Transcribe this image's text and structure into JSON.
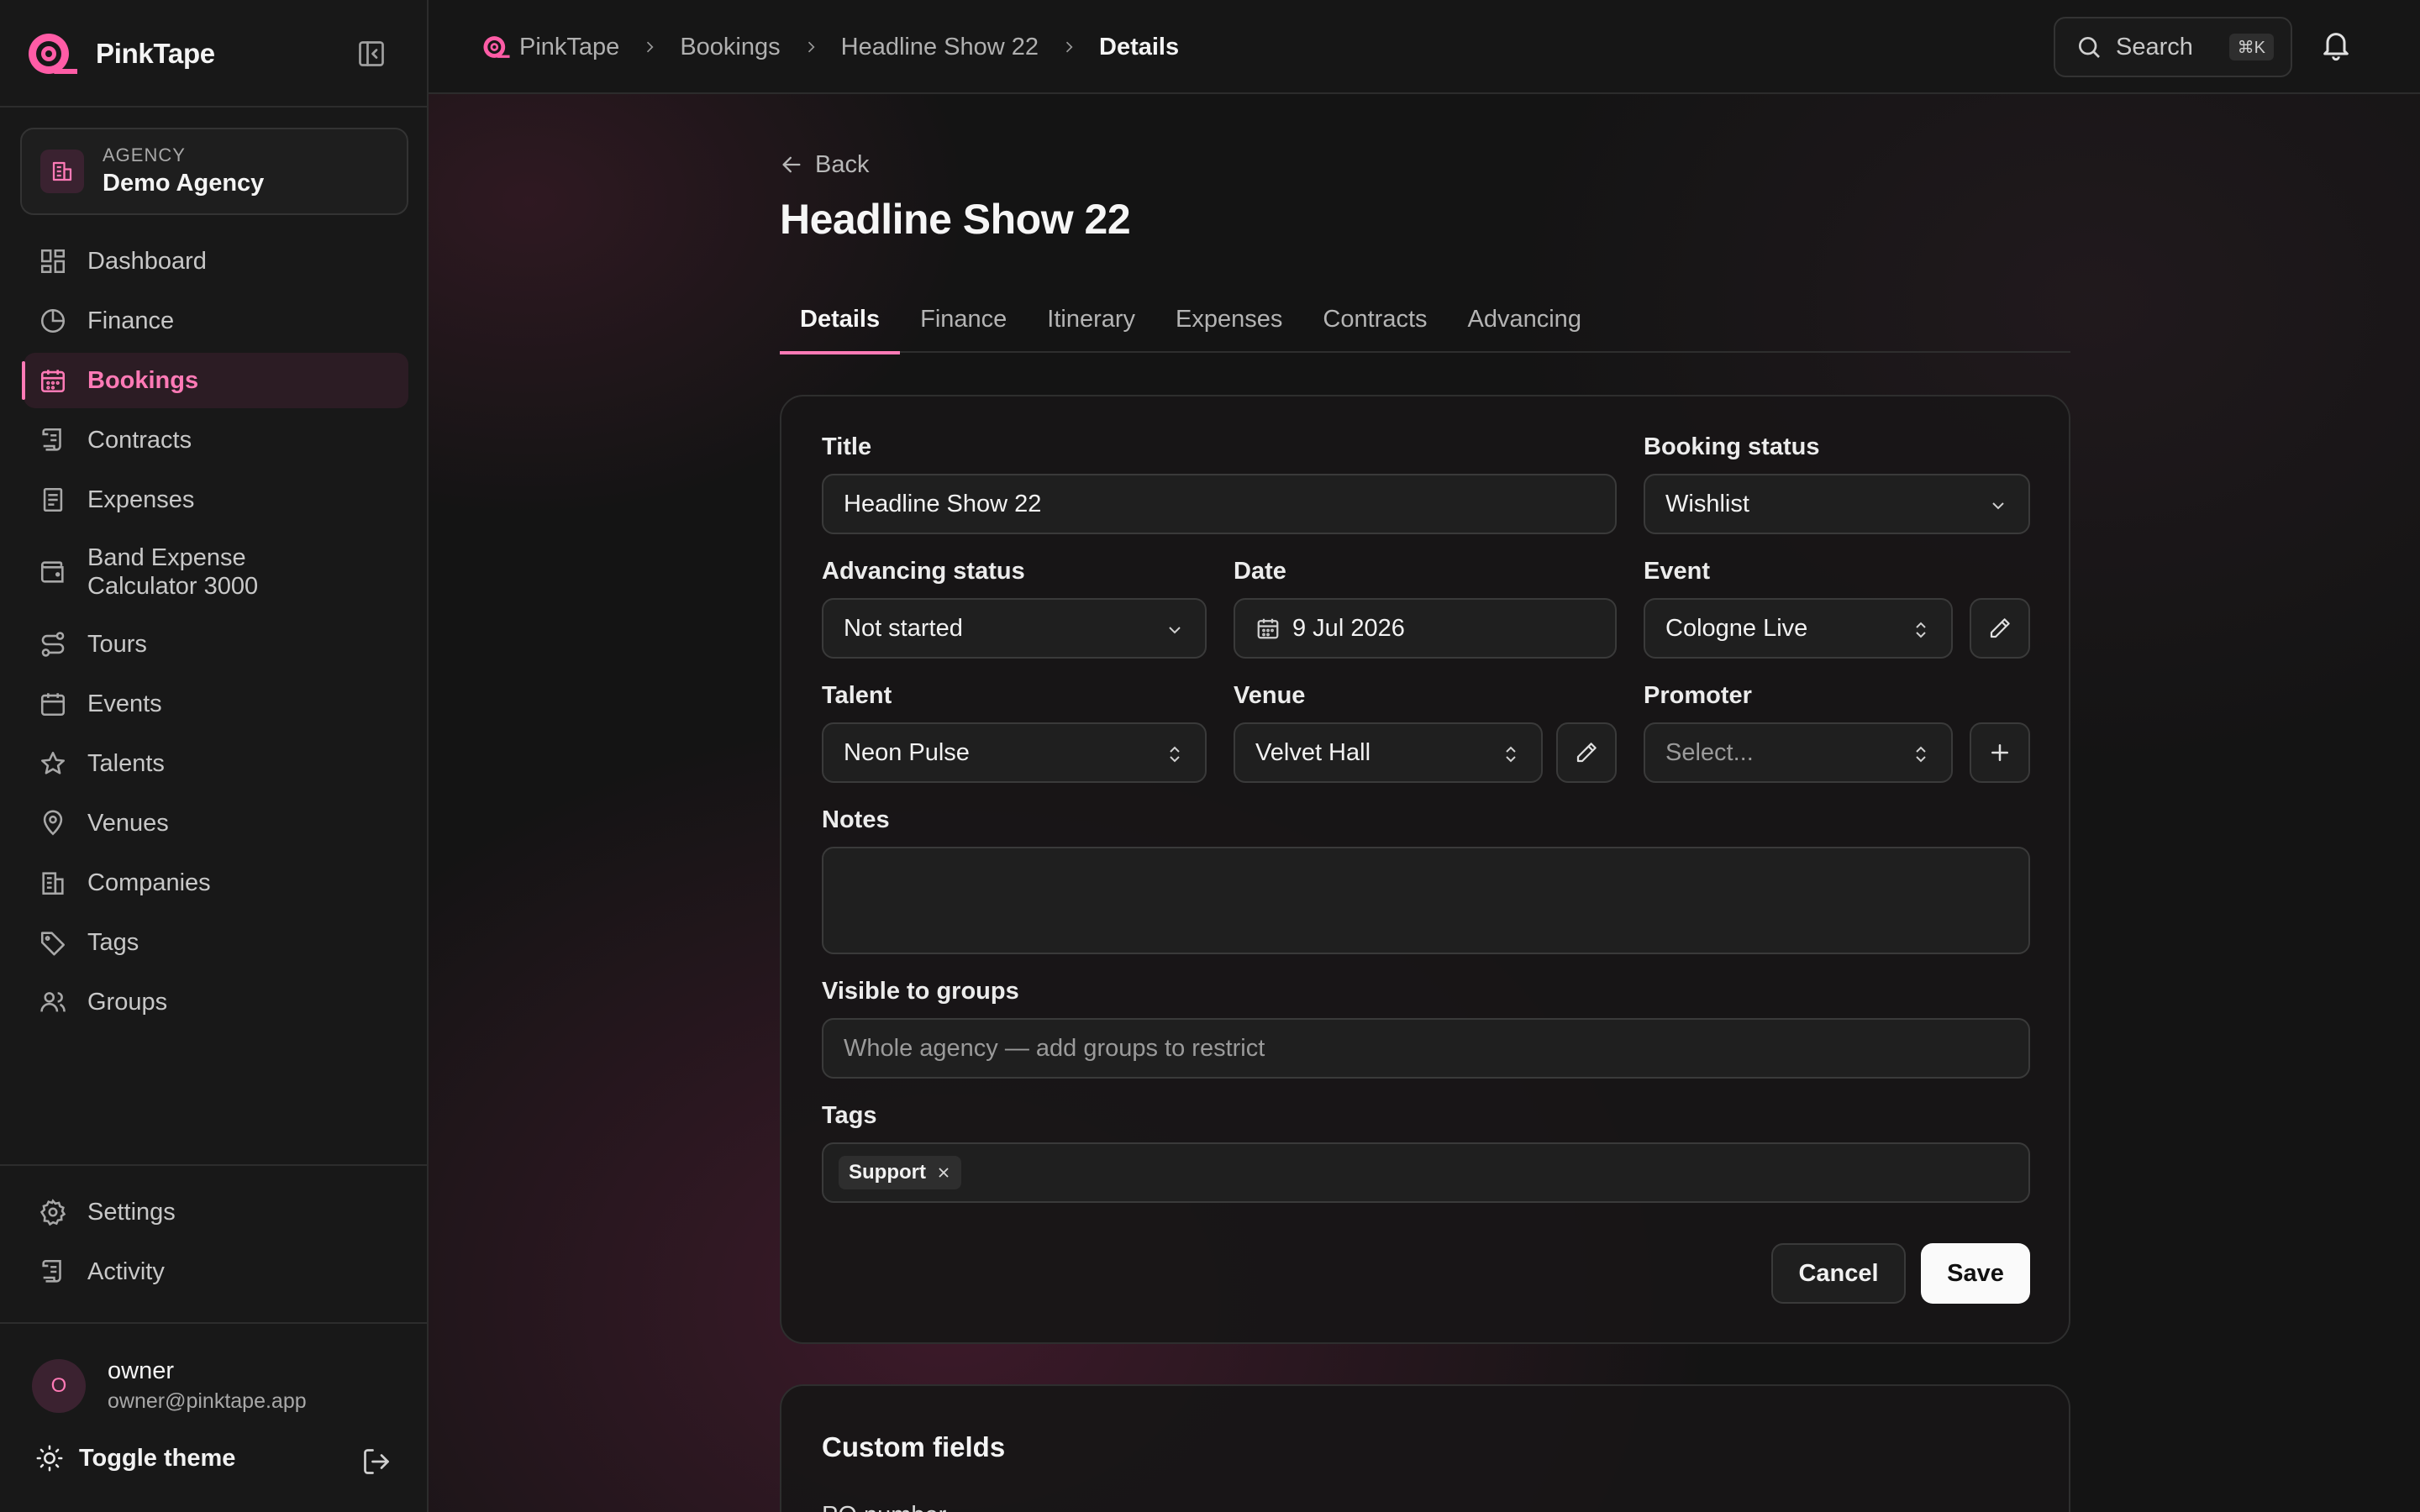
{
  "brand": {
    "name": "PinkTape"
  },
  "agency": {
    "label": "AGENCY",
    "name": "Demo Agency"
  },
  "sidebar": {
    "items": [
      {
        "label": "Dashboard",
        "icon": "dashboard-icon"
      },
      {
        "label": "Finance",
        "icon": "pie-chart-icon"
      },
      {
        "label": "Bookings",
        "icon": "calendar-icon",
        "active": true
      },
      {
        "label": "Contracts",
        "icon": "scroll-icon"
      },
      {
        "label": "Expenses",
        "icon": "receipt-icon"
      },
      {
        "label_line1": "Band Expense",
        "label_line2": "Calculator 3000",
        "icon": "wallet-icon"
      },
      {
        "label": "Tours",
        "icon": "route-icon"
      },
      {
        "label": "Events",
        "icon": "calendar-icon"
      },
      {
        "label": "Talents",
        "icon": "star-icon"
      },
      {
        "label": "Venues",
        "icon": "map-pin-icon"
      },
      {
        "label": "Companies",
        "icon": "building-icon"
      },
      {
        "label": "Tags",
        "icon": "tag-icon"
      },
      {
        "label": "Groups",
        "icon": "users-icon"
      }
    ],
    "bottom": [
      {
        "label": "Settings",
        "icon": "gear-icon"
      },
      {
        "label": "Activity",
        "icon": "scroll-icon"
      }
    ]
  },
  "user": {
    "initial": "O",
    "name": "owner",
    "email": "owner@pinktape.app"
  },
  "theme_toggle": "Toggle theme",
  "breadcrumb": [
    "PinkTape",
    "Bookings",
    "Headline Show 22",
    "Details"
  ],
  "search": {
    "label": "Search",
    "shortcut": "⌘K"
  },
  "page": {
    "back": "Back",
    "title": "Headline Show 22",
    "tabs": [
      "Details",
      "Finance",
      "Itinerary",
      "Expenses",
      "Contracts",
      "Advancing"
    ],
    "active_tab": "Details"
  },
  "form": {
    "title_label": "Title",
    "title_value": "Headline Show 22",
    "booking_status_label": "Booking status",
    "booking_status_value": "Wishlist",
    "advancing_status_label": "Advancing status",
    "advancing_status_value": "Not started",
    "date_label": "Date",
    "date_value": "9 Jul 2026",
    "event_label": "Event",
    "event_value": "Cologne Live",
    "talent_label": "Talent",
    "talent_value": "Neon Pulse",
    "venue_label": "Venue",
    "venue_value": "Velvet Hall",
    "promoter_label": "Promoter",
    "promoter_placeholder": "Select...",
    "notes_label": "Notes",
    "notes_value": "",
    "groups_label": "Visible to groups",
    "groups_placeholder": "Whole agency — add groups to restrict",
    "tags_label": "Tags",
    "tags": [
      "Support"
    ],
    "cancel_label": "Cancel",
    "save_label": "Save"
  },
  "custom_fields": {
    "title": "Custom fields",
    "first_field": "PO number"
  },
  "colors": {
    "accent": "#ff7ab6",
    "background": "#141414",
    "surface": "#1f1f1f"
  }
}
